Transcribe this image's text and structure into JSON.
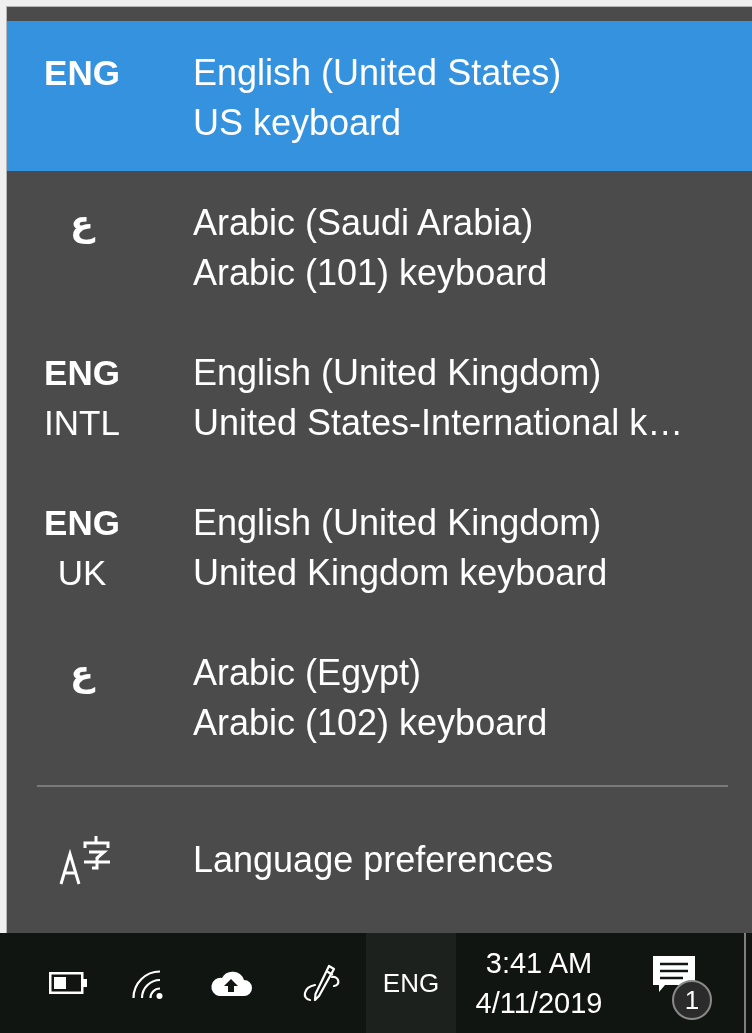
{
  "languages": [
    {
      "code": "ENG",
      "name": "English (United States)",
      "keyboard": "US keyboard",
      "selected": true
    },
    {
      "code": "ع",
      "name": "Arabic (Saudi Arabia)",
      "keyboard": "Arabic (101) keyboard",
      "selected": false
    },
    {
      "code": "ENG",
      "layout_code": "INTL",
      "name": "English (United Kingdom)",
      "keyboard": "United States-International k…",
      "selected": false
    },
    {
      "code": "ENG",
      "layout_code": "UK",
      "name": "English (United Kingdom)",
      "keyboard": "United Kingdom keyboard",
      "selected": false
    },
    {
      "code": "ع",
      "name": "Arabic (Egypt)",
      "keyboard": "Arabic (102) keyboard",
      "selected": false
    }
  ],
  "footer": {
    "label": "Language preferences"
  },
  "taskbar": {
    "input_indicator": {
      "label": "ENG",
      "selected": true
    },
    "clock": {
      "time": "3:41 AM",
      "date": "4/11/2019"
    },
    "notifications": {
      "count": "1"
    }
  }
}
